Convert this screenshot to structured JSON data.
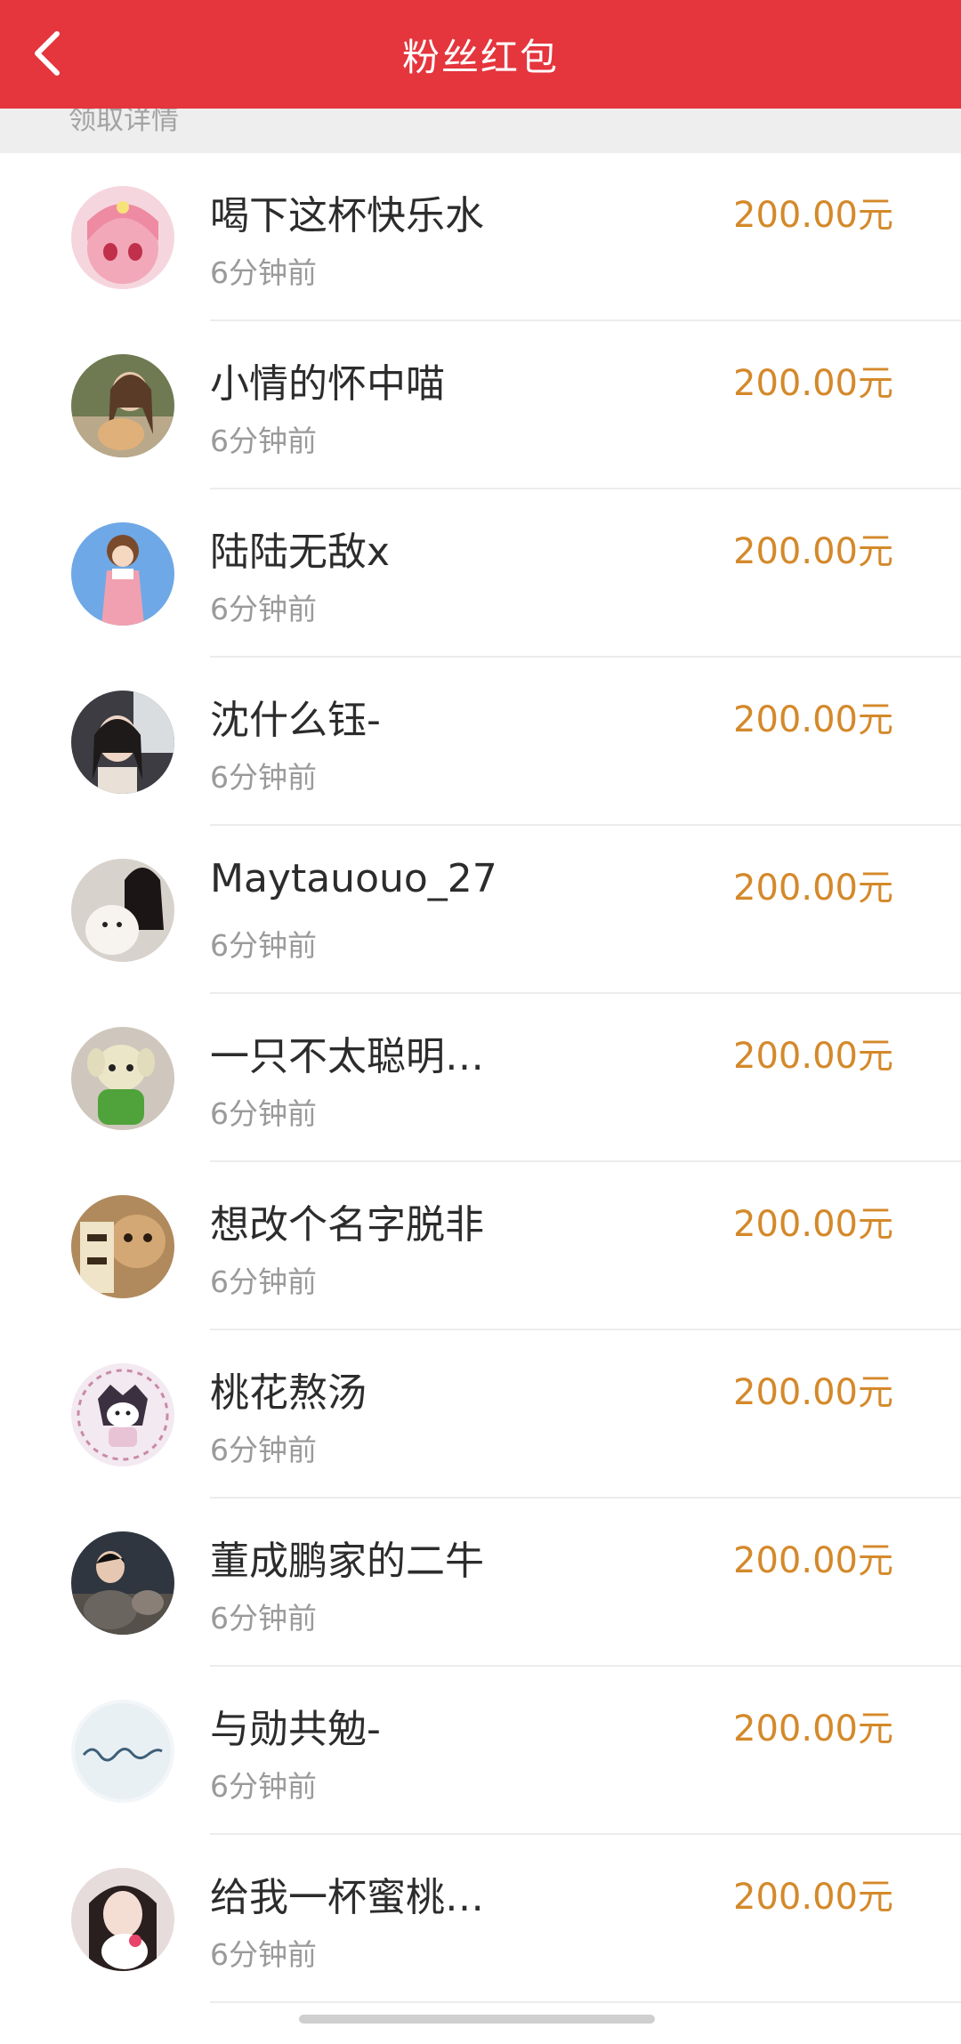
{
  "header": {
    "title": "粉丝红包"
  },
  "section": {
    "label": "领取详情"
  },
  "colors": {
    "header_bg": "#e5353d",
    "amount": "#d4892a"
  },
  "recipients": [
    {
      "name": "喝下这杯快乐水",
      "time": "6分钟前",
      "amount": "200.00元",
      "avatar": "pink-anime-girl"
    },
    {
      "name": "小情的怀中喵",
      "time": "6分钟前",
      "amount": "200.00元",
      "avatar": "girl-with-cat-photo"
    },
    {
      "name": "陆陆无敌x",
      "time": "6分钟前",
      "amount": "200.00元",
      "avatar": "cartoon-girl-pink-overalls"
    },
    {
      "name": "沈什么钰-",
      "time": "6分钟前",
      "amount": "200.00元",
      "avatar": "girl-in-car-photo"
    },
    {
      "name": "Maytauouo_27",
      "time": "6分钟前",
      "amount": "200.00元",
      "avatar": "girl-with-white-dog"
    },
    {
      "name": "一只不太聪明…",
      "time": "6分钟前",
      "amount": "200.00元",
      "avatar": "plush-toy-green"
    },
    {
      "name": "想改个名字脱非",
      "time": "6分钟前",
      "amount": "200.00元",
      "avatar": "cat-with-calligraphy"
    },
    {
      "name": "桃花熬汤",
      "time": "6分钟前",
      "amount": "200.00元",
      "avatar": "kuromi-sketch"
    },
    {
      "name": "董成鹏家的二牛",
      "time": "6分钟前",
      "amount": "200.00元",
      "avatar": "man-with-cat-photo"
    },
    {
      "name": "与勋共勉-",
      "time": "6分钟前",
      "amount": "200.00元",
      "avatar": "handwritten-text"
    },
    {
      "name": "给我一杯蜜桃…",
      "time": "6分钟前",
      "amount": "200.00元",
      "avatar": "girl-with-hello-kitty"
    }
  ]
}
